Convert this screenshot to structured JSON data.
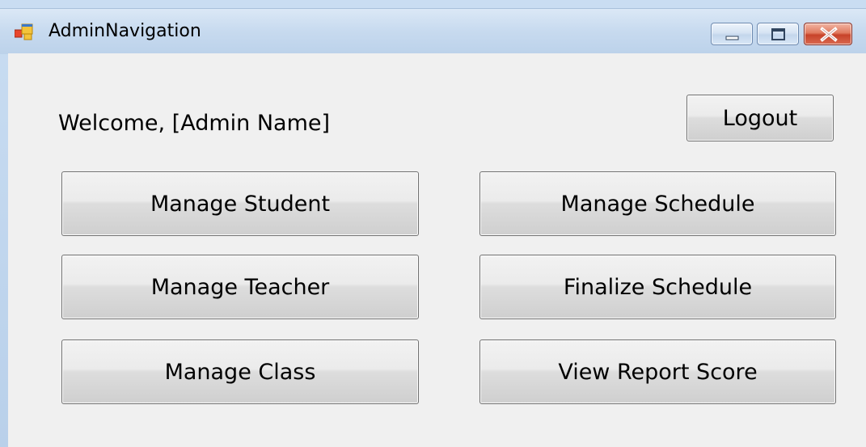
{
  "window": {
    "title": "AdminNavigation",
    "icon": "winforms-app-icon",
    "controls": {
      "minimize_icon": "minimize-icon",
      "maximize_icon": "maximize-icon",
      "close_icon": "close-icon"
    }
  },
  "header": {
    "welcome_text": "Welcome, [Admin Name]",
    "logout_label": "Logout"
  },
  "buttons": {
    "manage_student": "Manage Student",
    "manage_teacher": "Manage Teacher",
    "manage_class": "Manage Class",
    "manage_schedule": "Manage Schedule",
    "finalize_schedule": "Finalize Schedule",
    "view_report_score": "View Report Score"
  },
  "colors": {
    "client_background": "#f0f0f0",
    "titlebar": "#c7daef",
    "close_button": "#c7432a"
  }
}
